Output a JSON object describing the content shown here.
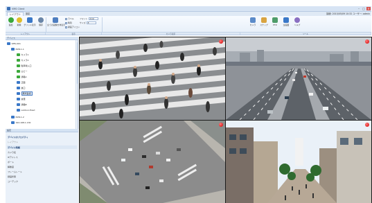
{
  "window": {
    "title": "VMS Client",
    "min": "–",
    "max": "□",
    "close": "×"
  },
  "tabs": [
    {
      "label": "レイアウト"
    },
    {
      "label": "設定"
    }
  ],
  "user_info": "接続: 2015/05/09 10:32 ユーザー: admin",
  "ribbon": {
    "buttons": [
      {
        "label": "追加",
        "color": "#3aa83a"
      },
      {
        "label": "削除",
        "color": "#e0bd2a"
      },
      {
        "label": "グリッド表示",
        "color": "#3a78c8"
      },
      {
        "label": "保存",
        "color": "#6a86a8"
      },
      {
        "label": "全ての画像を非表示",
        "color": "#4e7ec0"
      }
    ],
    "checks": [
      "ラベル",
      "時刻",
      "録画アイコン"
    ],
    "fields": [
      {
        "label": "フォント",
        "value": "Arial"
      },
      {
        "label": "サイズ",
        "value": "8"
      }
    ],
    "actions": [
      "カメラ",
      "スナップ",
      "PTZ",
      "全画面",
      "ヘルプ"
    ],
    "groups": [
      "レイアウト",
      "表示",
      "カメラ表示",
      "ツール"
    ]
  },
  "tree": {
    "header": "デバイス",
    "items": [
      {
        "label": "VMS-001",
        "level": 0,
        "color": "#3a78c8"
      },
      {
        "label": "NVR-1-1",
        "level": 1,
        "color": "#3a78c8"
      },
      {
        "label": "カメラ1",
        "level": 2,
        "color": "#3aa83a"
      },
      {
        "label": "カメラ2",
        "level": 2,
        "color": "#3aa83a"
      },
      {
        "label": "駐車場入口",
        "level": 2,
        "color": "#3aa83a"
      },
      {
        "label": "ロビー",
        "level": 2,
        "color": "#3aa83a"
      },
      {
        "label": "通路A",
        "level": 2,
        "color": "#3aa83a"
      },
      {
        "label": "正面",
        "level": 2,
        "color": "#3a78c8"
      },
      {
        "label": "裏口",
        "level": 2,
        "color": "#3a78c8"
      },
      {
        "label": "屋外監視",
        "level": 2,
        "color": "#3a78c8",
        "selected": true
      },
      {
        "label": "倉庫",
        "level": 2,
        "color": "#3a78c8"
      },
      {
        "label": "通路B",
        "level": 2,
        "color": "#3a78c8"
      },
      {
        "label": "outdoor-fixed",
        "level": 2,
        "color": "#3a78c8"
      },
      {
        "label": "NVR-1-2",
        "level": 1,
        "color": "#3a78c8"
      },
      {
        "label": "192.168.1.130",
        "level": 1,
        "color": "#3a78c8"
      }
    ]
  },
  "props": {
    "header": "設定",
    "title": "デバイスのプロパティ",
    "subtitle": "レイアウト",
    "section": "デバイス情報",
    "rows": [
      "カメラ名",
      "IPアドレス",
      "ポート",
      "解像度",
      "フレームレート",
      "録画状態",
      "コーデック"
    ]
  },
  "video": {
    "cells": [
      {
        "name": "crosswalk-feed",
        "recording": true
      },
      {
        "name": "highway-feed",
        "recording": true
      },
      {
        "name": "intersection-aerial-feed",
        "recording": true
      },
      {
        "name": "street-feed",
        "recording": true
      }
    ]
  }
}
